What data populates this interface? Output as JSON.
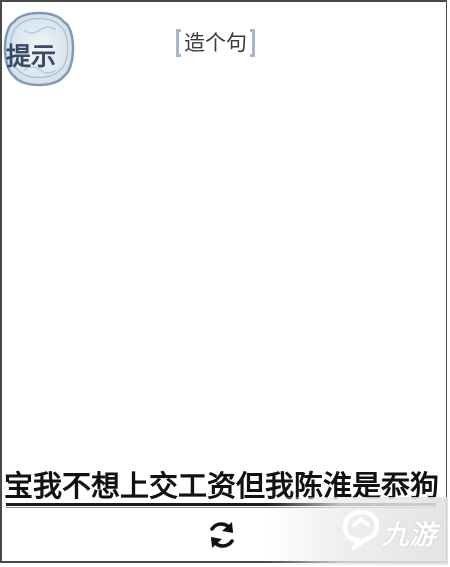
{
  "hint": {
    "label": "提示",
    "icon": "hint-badge-icon"
  },
  "title": "造个句",
  "sentence": "宝我不想上交工资但我陈淮是忝狗",
  "controls": {
    "refresh_icon": "refresh-icon"
  },
  "watermark": {
    "text": "九游",
    "icon": "jiuyou-logo"
  },
  "colors": {
    "frame": "#4a4a4a",
    "badge_fill": "#dbe6ee",
    "badge_border": "#7f9ab4",
    "badge_text": "#3a4a66",
    "bracket": "#a8b7c8",
    "sentence": "#111111"
  }
}
